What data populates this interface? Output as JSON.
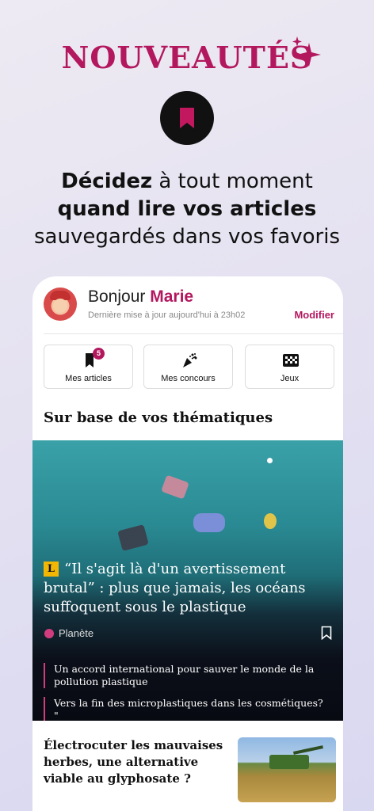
{
  "promo": {
    "title": "NOUVEAUTÉS",
    "headline_bold_1": "Décidez",
    "headline_rest_1": " à tout moment",
    "headline_bold_2": "quand lire vos articles",
    "headline_3": "sauvegardés dans vos favoris"
  },
  "colors": {
    "accent": "#b3185f",
    "tag_dot": "#d13c7f",
    "badge_yellow": "#f2b705"
  },
  "header": {
    "greeting": "Bonjour ",
    "user_name": "Marie",
    "last_update": "Dernière mise à jour aujourd'hui à 23h02",
    "modify_label": "Modifier"
  },
  "shortcuts": [
    {
      "label": "Mes articles",
      "icon": "bookmark-icon",
      "badge": "5"
    },
    {
      "label": "Mes  concours",
      "icon": "party-popper-icon"
    },
    {
      "label": "Jeux",
      "icon": "checkered-grid-icon"
    }
  ],
  "section_title": "Sur base de vos thématiques",
  "hero_article": {
    "badge": "L",
    "headline": "“Il s'agit là d'un avertissement brutal” : plus que jamais, les océans suffoquent sous le plastique",
    "category": "Planète",
    "related": [
      "Un accord international pour sauver le monde de la pollution plastique",
      "Vers la fin des microplastiques dans les cosmétiques? \""
    ]
  },
  "article2": {
    "headline": "Électrocuter les mauvaises herbes, une alternative viable au glyphosate ?"
  }
}
